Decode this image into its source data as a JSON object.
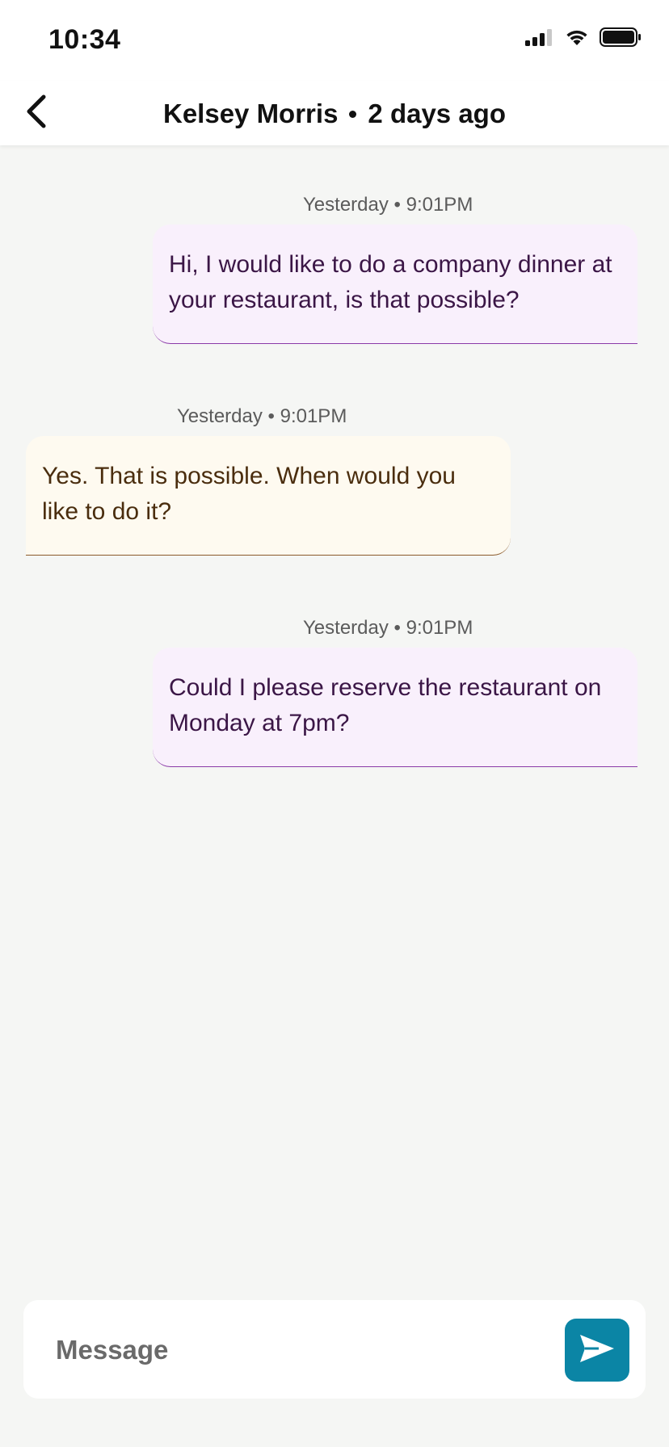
{
  "status_bar": {
    "time": "10:34"
  },
  "header": {
    "contact_name": "Kelsey Morris",
    "last_seen": "2 days ago"
  },
  "messages": [
    {
      "direction": "sent",
      "timestamp": "Yesterday • 9:01PM",
      "text": "Hi, I would like to do a company dinner at your restaurant, is that possible?"
    },
    {
      "direction": "received",
      "timestamp": "Yesterday • 9:01PM",
      "text": "Yes. That is possible. When would you like to do it?"
    },
    {
      "direction": "sent",
      "timestamp": "Yesterday • 9:01PM",
      "text": "Could I please reserve the restaurant on Monday at 7pm?"
    }
  ],
  "composer": {
    "placeholder": "Message",
    "value": ""
  },
  "icons": {
    "back": "chevron-left-icon",
    "send": "send-icon",
    "signal": "cellular-signal-icon",
    "wifi": "wifi-icon",
    "battery": "battery-icon"
  },
  "colors": {
    "sent_bubble": "#f9f0fc",
    "sent_text": "#3b1646",
    "received_bubble": "#fefaf0",
    "received_text": "#4a2d0e",
    "send_button": "#0b85a5",
    "background": "#f5f6f4"
  }
}
